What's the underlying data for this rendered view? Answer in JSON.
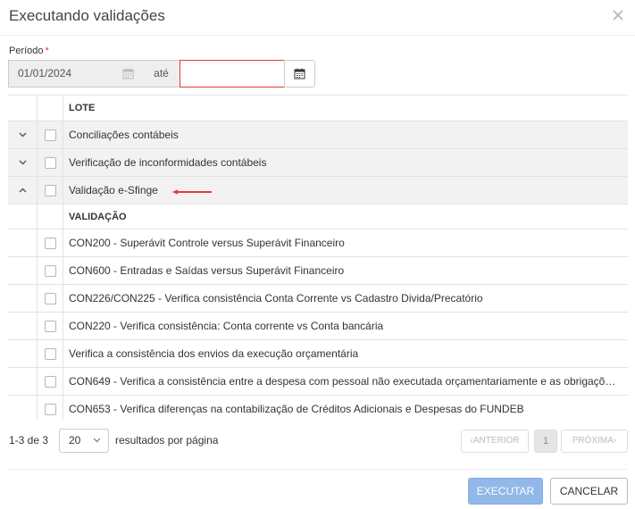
{
  "dialog": {
    "title": "Executando validações"
  },
  "period": {
    "label": "Período",
    "required_mark": "*",
    "start_value": "01/01/2024",
    "separator": "até",
    "end_value": ""
  },
  "grid": {
    "header": "LOTE",
    "groups": [
      {
        "label": "Conciliações contábeis",
        "expanded": false
      },
      {
        "label": "Verificação de inconformidades contábeis",
        "expanded": false
      },
      {
        "label": "Validação e-Sfinge",
        "expanded": true
      }
    ],
    "sub_header": "VALIDAÇÃO",
    "validations": [
      "CON200 - Superávit Controle versus Superávit Financeiro",
      "CON600 - Entradas e Saídas versus Superávit Financeiro",
      "CON226/CON225 - Verifica consistência Conta Corrente vs Cadastro Divida/Precatório",
      "CON220 - Verifica consistência: Conta corrente vs Conta bancária",
      "Verifica a consistência dos envios da execução orçamentária",
      "CON649 - Verifica a consistência entre a despesa com pessoal não executada orçamentariamente e as obrigações...",
      "CON653 - Verifica diferenças na contabilização de Créditos Adicionais e Despesas do FUNDEB"
    ]
  },
  "pagination": {
    "count": "1-3 de 3",
    "page_size": "20",
    "per_page_label": "resultados por página",
    "prev_label": "ANTERIOR",
    "current_page": "1",
    "next_label": "PRÓXIMA"
  },
  "footer": {
    "execute_label": "EXECUTAR",
    "cancel_label": "CANCELAR"
  },
  "colors": {
    "annotation_arrow": "#e53935",
    "execute_button": "#91b8e8",
    "required": "#e53935"
  },
  "icons": {
    "close": "close-icon",
    "calendar": "calendar-icon",
    "collapse": "chevron-up-icon",
    "expand": "chevron-down-icon"
  }
}
